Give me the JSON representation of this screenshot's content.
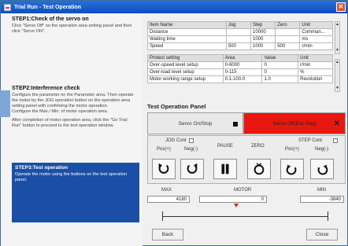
{
  "window": {
    "title": "Trial Run - Test Operation"
  },
  "left": {
    "step1": {
      "title": "STEP1:Check of the servo on",
      "text": "Click \"Servo Off\" on the operation area setting panel and then click \"Servo ON\"."
    },
    "step2": {
      "title": "STEP2:Interference check",
      "text": "Configure the parameter on the Parameter area. Then operate the motor by the JOG operation button on the operation area setting panel with confirming the motor operation.\nConfigure the Max./ Min. of motor operation area.",
      "text2": "After completion of motor operation area, click the \"Go Trial Run\" button to proceed to the test operation window."
    },
    "step3": {
      "title": "STEP3:Test operation",
      "text": "Operate the motor using the buttons on the test operation panel."
    }
  },
  "param_table": {
    "headers": [
      "Item Name",
      "Jog",
      "Step",
      "Zero",
      "Unit"
    ],
    "rows": [
      [
        "Distance",
        "",
        "10000",
        "",
        "Comman..."
      ],
      [
        "Waiting time",
        "",
        "1000",
        "",
        "ms"
      ],
      [
        "Speed",
        "500",
        "1000",
        "500",
        "r/min"
      ]
    ]
  },
  "protect_table": {
    "headers": [
      "Protect setting",
      "Area",
      "Value",
      "Unit"
    ],
    "rows": [
      [
        "Over-speed level setup",
        "0-6000",
        "0",
        "r/min"
      ],
      [
        "Over-load level setup",
        "0-115",
        "0",
        "%"
      ],
      [
        "Motor working range setup",
        "0.1-100.0",
        "1.0",
        "Revolution"
      ]
    ]
  },
  "panel": {
    "title": "Test Operation Panel",
    "servo_on": "Servo On/Stop",
    "servo_off": "Servo Off(Esc Key)",
    "jog_cont": "JOG Cont",
    "pause": "PAUSE",
    "zero": "ZERO",
    "step_cont": "STEP Cont",
    "pos": "Pos(+)",
    "neg": "Neg(-)"
  },
  "range": {
    "max_label": "MAX",
    "motor_label": "MOTOR",
    "min_label": "MIN",
    "max_value": "4180",
    "motor_value": "0",
    "min_value": "-3840"
  },
  "footer": {
    "back": "Back",
    "close": "Close"
  },
  "colors": {
    "servo_off_bg": "#e8170f",
    "step3_bg": "#1b4fa5",
    "title_bar": "#0a4fbf"
  }
}
